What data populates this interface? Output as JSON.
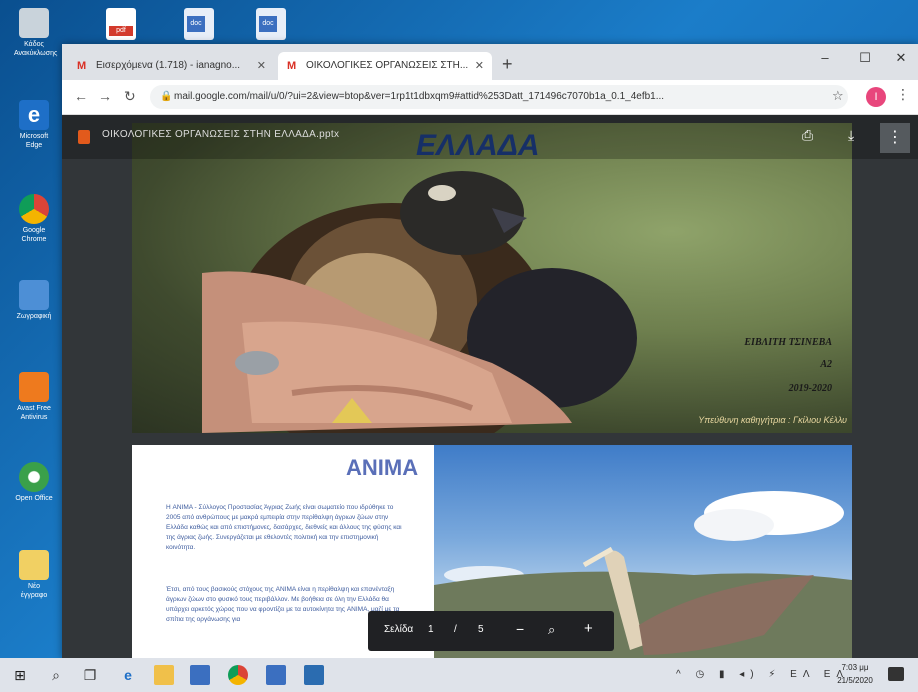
{
  "desktop": {
    "icons": [
      {
        "label": "Κάδος Ανακύκλωσης",
        "color": "#c9d3db"
      },
      {
        "label": "Microsoft Edge",
        "color": "#1e6fc7"
      },
      {
        "label": "Google Chrome",
        "color": "#e8c33a"
      },
      {
        "label": "Ζωγραφική",
        "color": "#4d8fd6"
      },
      {
        "label": "Avast Free Antivirus",
        "color": "#ee7a1e"
      },
      {
        "label": "Open Office",
        "color": "#3aa04a"
      },
      {
        "label": "Νέο έγγραφο",
        "color": "#f1d063"
      }
    ],
    "top_icons": [
      {
        "label": "pdf",
        "color": "#d33a2c"
      },
      {
        "label": "doc",
        "color": "#3b6fc0"
      },
      {
        "label": "doc",
        "color": "#3b6fc0"
      }
    ]
  },
  "browser": {
    "tabs": [
      {
        "label": "Εισερχόμενα (1.718) - ianagno...",
        "close": "✕"
      },
      {
        "label": "ΟΙΚΟΛΟΓΙΚΕΣ ΟΡΓΑΝΩΣΕΙΣ ΣΤΗ...",
        "close": "✕"
      }
    ],
    "new_tab": "+",
    "window_controls": {
      "minimize": "–",
      "maximize": "☐",
      "close": "✕"
    },
    "url": "mail.google.com/mail/u/0/?ui=2&view=btop&ver=1rp1t1dbxqm9#attid%253Datt_171496c7070b1a_0.1_4efb1...",
    "profile_initial": "Ι"
  },
  "viewer": {
    "file_name": "ΟΙΚΟΛΟΓΙΚΕΣ ΟΡΓΑΝΩΣΕΙΣ ΣΤΗΝ ΕΛΛΑΔΑ.pptx",
    "page1": {
      "title": "ΕΛΛΑΔΑ",
      "lines": [
        "ΕΙΒΛΙΤΗ ΤΣΙΝΕΒΑ",
        "Α2",
        "2019-2020"
      ],
      "footer": "Υπεύθυνη καθηγήτρια : Γκίλιου Κέλλυ"
    },
    "page2": {
      "title": "ANIMA",
      "para1": "Η ANIMA - Σύλλογος Προστασίας Άγριας Ζωής είναι σωματείο που ιδρύθηκε το 2005 από ανθρώπους με μακρά εμπειρία στην περίθαλψη άγριων ζώων στην Ελλάδα καθώς και από επιστήμονες, δασάρχες, διεθνείς και άλλους της φύσης και της άγριας ζωής. Συνεργάζεται με εθελοντές πολιτική και την επιστημονική κοινότητα.",
      "para2": "Έτσι, από τους βασικούς στόχους της ANIMA είναι η περίθαλψη και επανένταξη άγριων ζώων στο φυσικό τους περιβάλλον. Με βοήθεια σε όλη την Ελλάδα θα υπάρχει αρκετός χώρος που να φροντίζει με τα αυτοκίνητα της ANIMA, μαζί με τα σπίτια της οργάνωσης για"
    },
    "toolbar": {
      "page_label": "Σελίδα",
      "current_page": "1",
      "separator": "/",
      "total_pages": "5",
      "zoom_out": "−",
      "zoom_in": "+"
    }
  },
  "taskbar": {
    "time": "7:03 μμ",
    "date": "21/5/2020",
    "tray": "^ ◷ ▮ ◂) ⚡ ΕΛ ΕΛ"
  }
}
